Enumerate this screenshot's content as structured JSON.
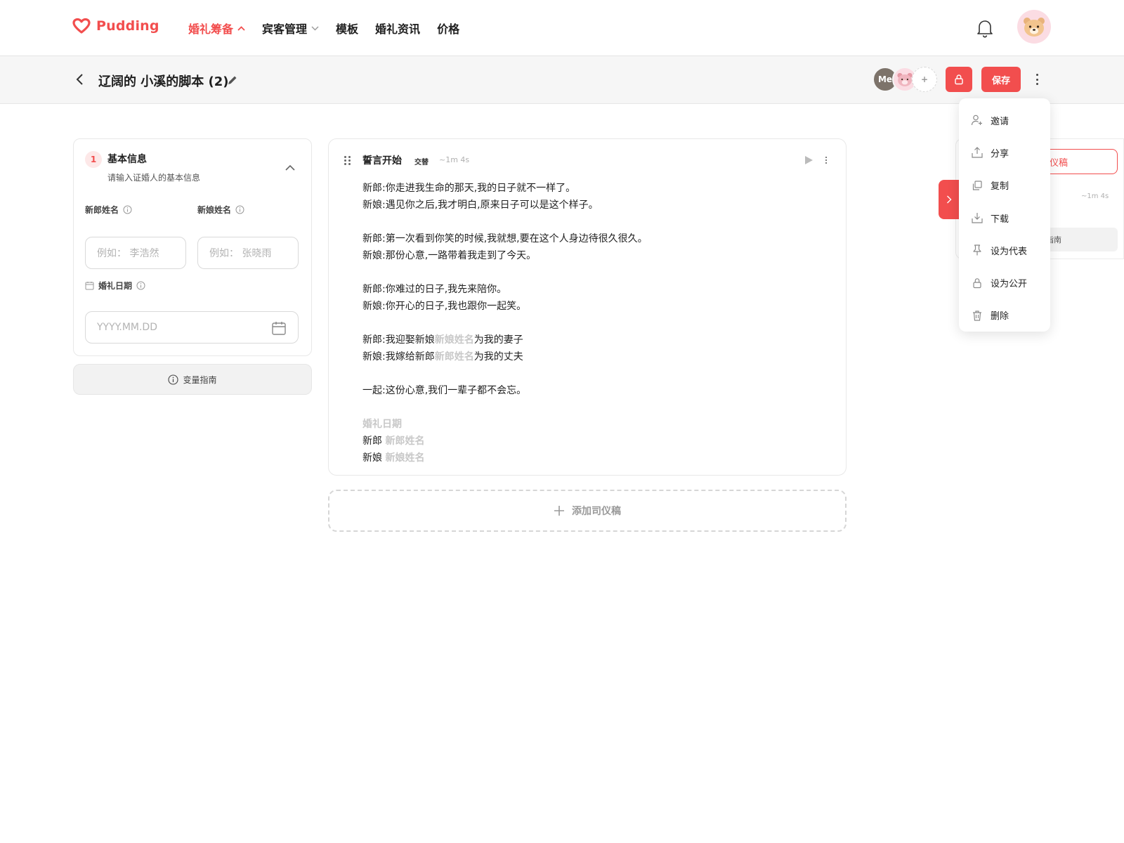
{
  "brand": {
    "name": "Pudding",
    "accent": "#f24e4e"
  },
  "nav": {
    "items": [
      {
        "label": "婚礼筹备",
        "active": true,
        "has_dropdown": true
      },
      {
        "label": "宾客管理",
        "active": false,
        "has_dropdown": true
      },
      {
        "label": "模板",
        "active": false,
        "has_dropdown": false
      },
      {
        "label": "婚礼资讯",
        "active": false,
        "has_dropdown": false
      },
      {
        "label": "价格",
        "active": false,
        "has_dropdown": false
      }
    ]
  },
  "document": {
    "title": "辽阔的 小溪的脚本 (2)"
  },
  "collaborators": {
    "me_label": "Me",
    "add_label": "+"
  },
  "toolbar": {
    "save_label": "保存"
  },
  "basic_info": {
    "step": "1",
    "title": "基本信息",
    "subtitle": "请输入证婚人的基本信息",
    "groom_label": "新郎姓名",
    "groom_placeholder": "例如： 李浩然",
    "bride_label": "新娘姓名",
    "bride_placeholder": "例如： 张晓雨",
    "date_label": "婚礼日期",
    "date_placeholder": "YYYY.MM.DD"
  },
  "guide_button": "变量指南",
  "script_card": {
    "title": "誓言开始",
    "tag": "交替",
    "duration": "~1m 4s",
    "lines": {
      "l1": "新郎:你走进我生命的那天,我的日子就不一样了。",
      "l2": "新娘:遇见你之后,我才明白,原来日子可以是这个样子。",
      "l3": "新郎:第一次看到你笑的时候,我就想,要在这个人身边待很久很久。",
      "l4": "新娘:那份心意,一路带着我走到了今天。",
      "l5": "新郎:你难过的日子,我先来陪你。",
      "l6": "新娘:你开心的日子,我也跟你一起笑。",
      "l7a": "新郎:我迎娶新娘",
      "l7var": "新娘姓名",
      "l7b": "为我的妻子",
      "l8a": "新娘:我嫁给新郎",
      "l8var": "新郎姓名",
      "l8b": "为我的丈夫",
      "l9": "一起:这份心意,我们一辈子都不会忘。",
      "l10var": "婚礼日期",
      "l11a": "新郎 ",
      "l11var": "新郎姓名",
      "l12a": "新娘 ",
      "l12var": "新娘姓名"
    }
  },
  "add_script_label": "添加司仪稿",
  "right_panel": {
    "button_partial": "仪稿",
    "time": "~1m 4s",
    "guide_partial": "指南"
  },
  "menu": {
    "items": [
      {
        "label": "邀请",
        "icon": "invite-icon"
      },
      {
        "label": "分享",
        "icon": "share-icon"
      },
      {
        "label": "复制",
        "icon": "copy-icon"
      },
      {
        "label": "下载",
        "icon": "download-icon"
      },
      {
        "label": "设为代表",
        "icon": "pin-icon"
      },
      {
        "label": "设为公开",
        "icon": "lock-icon"
      },
      {
        "label": "删除",
        "icon": "trash-icon"
      }
    ]
  }
}
